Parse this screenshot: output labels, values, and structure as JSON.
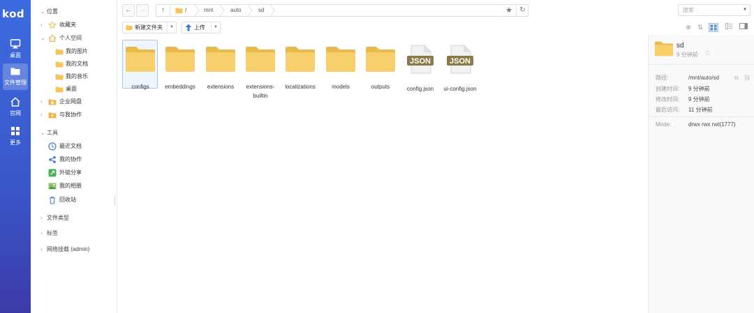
{
  "app": {
    "logo": "kod"
  },
  "rail": {
    "items": [
      {
        "label": "桌面",
        "icon": "monitor-icon"
      },
      {
        "label": "文件管理",
        "icon": "folder-icon",
        "active": true
      },
      {
        "label": "官网",
        "icon": "home-icon"
      },
      {
        "label": "更多",
        "icon": "grid-icon"
      }
    ]
  },
  "tree": {
    "location_header": "位置",
    "favorites": "收藏夹",
    "personal_space": "个人空间",
    "personal_children": [
      "我的图片",
      "我的文档",
      "我的音乐",
      "桌面"
    ],
    "enterprise_disk": "企业网盘",
    "collab_with_me": "与我协作",
    "tools_header": "工具",
    "tools": [
      "最近文档",
      "我的协作",
      "外链分享",
      "我的相册",
      "回收站"
    ],
    "file_types": "文件类型",
    "tags": "标签",
    "network_mount": "网络挂载 (admin)"
  },
  "toolbar": {
    "breadcrumb": [
      "/",
      "mnt",
      "auto",
      "sd"
    ],
    "new_folder": "新建文件夹",
    "upload": "上传",
    "search_placeholder": "搜索"
  },
  "files": [
    {
      "name": "configs",
      "type": "folder",
      "selected": true
    },
    {
      "name": "embeddings",
      "type": "folder"
    },
    {
      "name": "extensions",
      "type": "folder"
    },
    {
      "name": "extensions-builtin",
      "type": "folder"
    },
    {
      "name": "localizations",
      "type": "folder"
    },
    {
      "name": "models",
      "type": "folder"
    },
    {
      "name": "outputs",
      "type": "folder"
    },
    {
      "name": "config.json",
      "type": "json"
    },
    {
      "name": "ui-config.json",
      "type": "json"
    }
  ],
  "json_badge": "JSON",
  "details": {
    "name": "sd",
    "subtitle": "9 分钟前",
    "props": [
      {
        "key": "路径:",
        "value": "/mnt/auto/sd"
      },
      {
        "key": "创建时间:",
        "value": "9 分钟前"
      },
      {
        "key": "修改时间:",
        "value": "9 分钟前"
      },
      {
        "key": "最后访问:",
        "value": "11 分钟前"
      }
    ],
    "mode_key": "Mode:",
    "mode_value": "drwx rwx rwt(1777)"
  },
  "colors": {
    "rail_top": "#3b6be0",
    "rail_bottom": "#3c3aa8",
    "folder": "#f7cf6b",
    "selection": "#eef5fd"
  }
}
